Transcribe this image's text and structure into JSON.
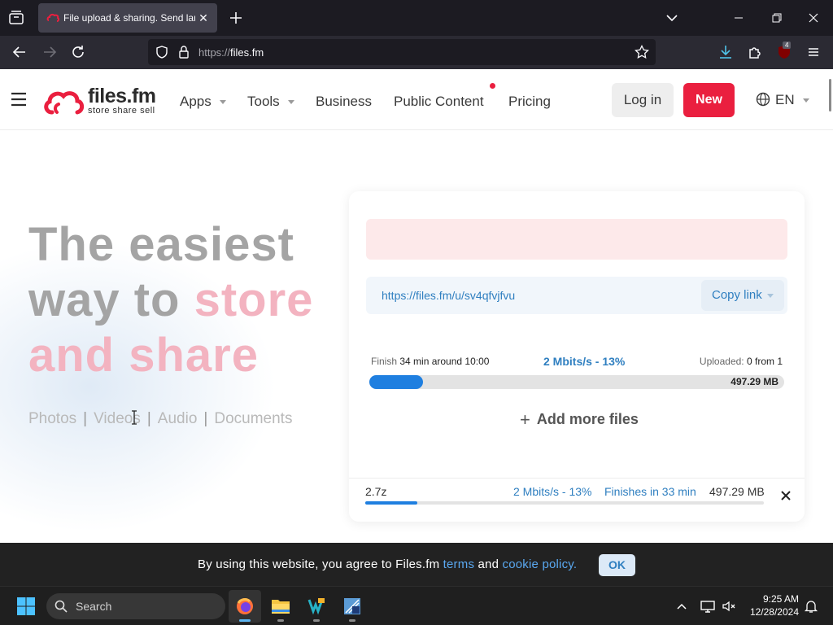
{
  "browser": {
    "tab": {
      "title": "File upload & sharing. Send large files"
    },
    "url": {
      "scheme": "https://",
      "host": "files.fm"
    },
    "extension_badge": "4"
  },
  "site": {
    "logo": {
      "name": "files.fm",
      "tagline": "store  share  sell"
    },
    "menu": {
      "apps": "Apps",
      "tools": "Tools",
      "business": "Business",
      "public_content": "Public Content",
      "pricing": "Pricing"
    },
    "login": "Log in",
    "new": "New",
    "language": "EN"
  },
  "hero": {
    "line1": "The easiest",
    "line2_a": "way to ",
    "line2_b": "store",
    "line3": "and share",
    "types": [
      "Photos",
      "Videos",
      "Audio",
      "Documents"
    ],
    "separator": "|"
  },
  "upload": {
    "share_link": "https://files.fm/u/sv4qfvjfvu",
    "copy_link": "Copy link",
    "finish_label": "Finish",
    "finish_value": "34 min around 10:00",
    "speed": "2 Mbits/s - 13%",
    "uploaded_label": "Uploaded:",
    "uploaded_value": "0 from 1",
    "progress": 0.13,
    "total_size": "497.29 MB",
    "add_more": "Add more files",
    "file": {
      "name": "2.7z",
      "speed": "2 Mbits/s - 13%",
      "finish": "Finishes in 33 min",
      "size": "497.29 MB",
      "progress": 0.13
    }
  },
  "cookie": {
    "text_before": "By using this website, you agree to Files.fm ",
    "terms": "terms",
    "and": " and ",
    "policy": "cookie policy.",
    "ok": "OK"
  },
  "taskbar": {
    "search": "Search",
    "time": "9:25 AM",
    "date": "12/28/2024"
  },
  "colors": {
    "brand_red": "#ea1f3f",
    "link_blue": "#2f7fc0",
    "progress_blue": "#1f7fe0",
    "hero_pink": "#f3b3c0"
  }
}
